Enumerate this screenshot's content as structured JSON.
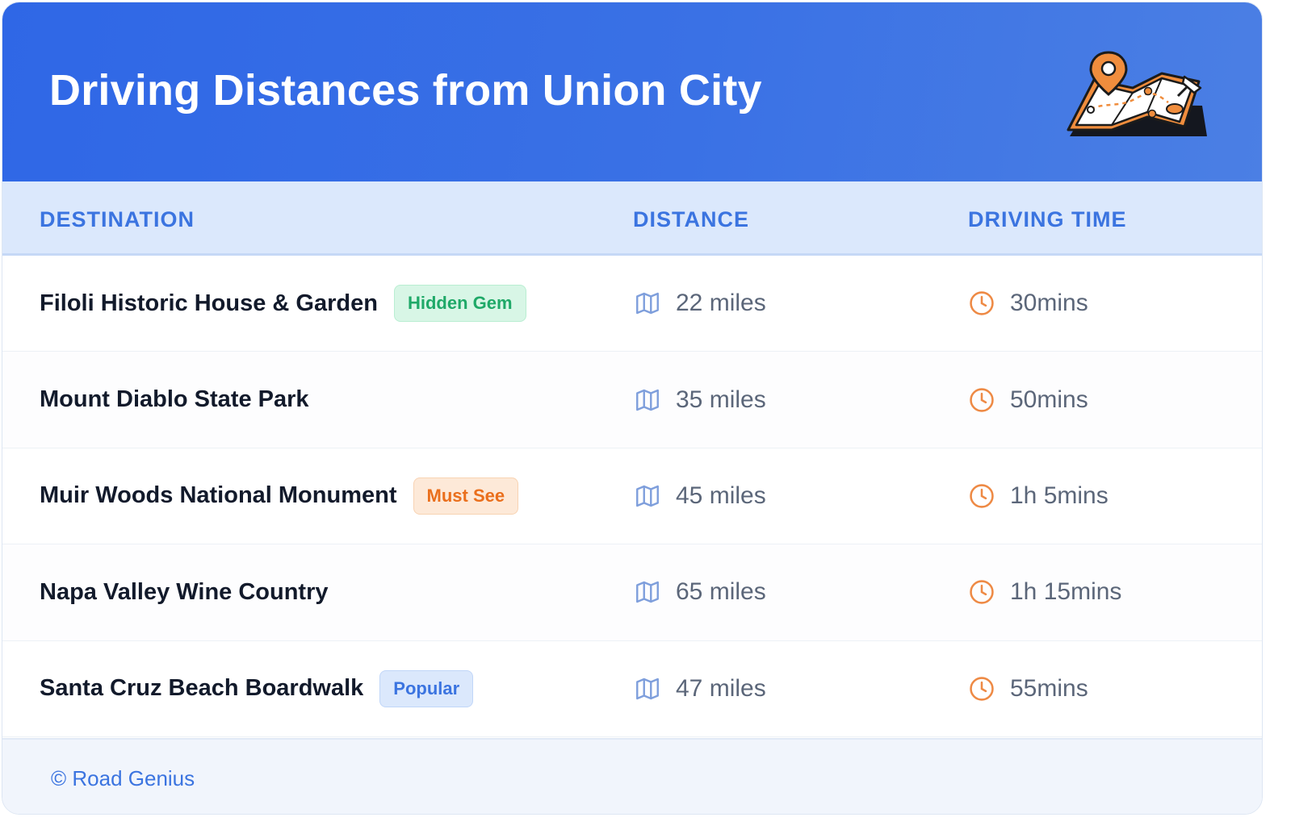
{
  "header": {
    "title": "Driving Distances from Union City"
  },
  "table": {
    "columns": {
      "destination": "DESTINATION",
      "distance": "DISTANCE",
      "driving_time": "DRIVING TIME"
    },
    "rows": [
      {
        "destination": "Filoli Historic House & Garden",
        "badge": "Hidden Gem",
        "badge_color": "#1fa968",
        "distance": "22 miles",
        "time": "30mins"
      },
      {
        "destination": "Mount Diablo State Park",
        "badge": "",
        "badge_color": "",
        "distance": "35 miles",
        "time": "50mins"
      },
      {
        "destination": "Muir Woods National Monument",
        "badge": "Must See",
        "badge_color": "#ea6f1c",
        "distance": "45 miles",
        "time": "1h 5mins"
      },
      {
        "destination": "Napa Valley Wine Country",
        "badge": "",
        "badge_color": "",
        "distance": "65 miles",
        "time": "1h 15mins"
      },
      {
        "destination": "Santa Cruz Beach Boardwalk",
        "badge": "Popular",
        "badge_color": "#3b74e0",
        "distance": "47 miles",
        "time": "55mins"
      }
    ]
  },
  "icons": {
    "distance": "map-icon",
    "time": "clock-icon",
    "header": "map-pin-illustration"
  },
  "footer": {
    "text": "© Road Genius"
  },
  "colors": {
    "header_bg": "#2f67e6",
    "accent": "#3b74e0",
    "clock": "#ee8a45",
    "map": "#7f9fdc"
  }
}
